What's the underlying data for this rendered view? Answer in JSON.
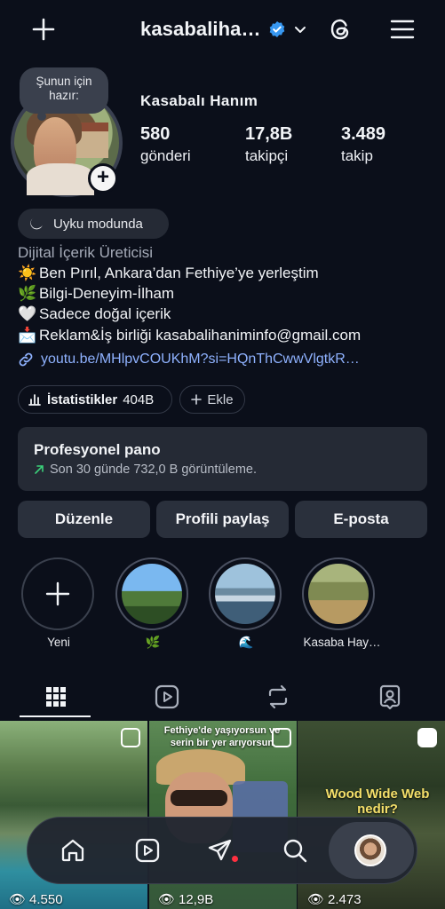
{
  "header": {
    "username": "kasabaliha…",
    "verified": true,
    "plus_icon": "plus-icon",
    "threads_icon": "threads-icon",
    "menu_icon": "hamburger-menu-icon"
  },
  "profile": {
    "note": "Şunun için hazır:",
    "display_name": "Kasabalı Hanım",
    "stats": [
      {
        "value": "580",
        "label": "gönderi"
      },
      {
        "value": "17,8B",
        "label": "takipçi"
      },
      {
        "value": "3.489",
        "label": "takip"
      }
    ],
    "status_chip": "Uyku modunda",
    "category": "Dijital İçerik Üreticisi",
    "bio": [
      {
        "emoji": "☀️",
        "text": "Ben Pırıl, Ankara’dan Fethiye’ye yerleştim"
      },
      {
        "emoji": "🌿",
        "text": "Bilgi-Deneyim-İlham"
      },
      {
        "emoji": "🤍",
        "text": "Sadece doğal içerik"
      },
      {
        "emoji": "📩",
        "text": "Reklam&İş birliği kasabalihaniminfo@gmail.com"
      }
    ],
    "link": "youtu.be/MHlpvCOUKhM?si=HQnThCwwVlgtkR…"
  },
  "chips": {
    "insights_label": "İstatistikler",
    "insights_value": "404B",
    "add_label": "Ekle"
  },
  "pro_dashboard": {
    "title": "Profesyonel pano",
    "subtitle": "Son 30 günde 732,0 B görüntüleme."
  },
  "actions": {
    "edit": "Düzenle",
    "share": "Profili paylaş",
    "email": "E-posta"
  },
  "highlights": [
    {
      "label": "Yeni"
    },
    {
      "label": "🌿"
    },
    {
      "label": "🌊"
    },
    {
      "label": "Kasaba Hay…"
    }
  ],
  "tabs": [
    "grid-icon",
    "reels-icon",
    "reposts-icon",
    "tagged-icon"
  ],
  "posts": [
    {
      "views": "4.550"
    },
    {
      "views": "12,9B",
      "caption": "Fethiye'de yaşıyorsun ve serin bir yer arıyorsun"
    },
    {
      "views": "2.473",
      "title": "Wood Wide Web nedir?"
    }
  ],
  "colors": {
    "background": "#0b0f1a",
    "card": "#252a35",
    "link": "#8fb2ff",
    "verified": "#3797f0",
    "trend_up": "#3bd17a",
    "notification_dot": "#ff3040"
  }
}
